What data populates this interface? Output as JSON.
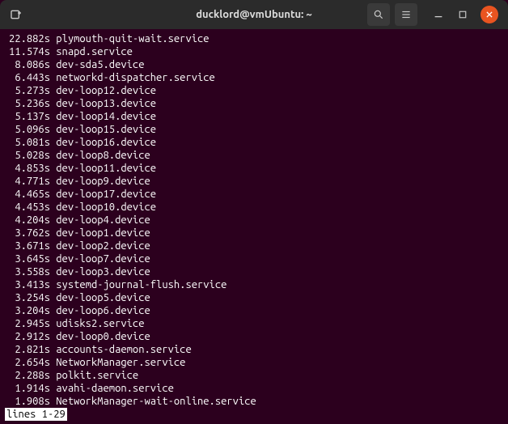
{
  "titlebar": {
    "title": "ducklord@vmUbuntu: ~"
  },
  "lines": [
    {
      "time": "22.882s",
      "name": "plymouth-quit-wait.service"
    },
    {
      "time": "11.574s",
      "name": "snapd.service"
    },
    {
      "time": "8.086s",
      "name": "dev-sda5.device"
    },
    {
      "time": "6.443s",
      "name": "networkd-dispatcher.service"
    },
    {
      "time": "5.273s",
      "name": "dev-loop12.device"
    },
    {
      "time": "5.236s",
      "name": "dev-loop13.device"
    },
    {
      "time": "5.137s",
      "name": "dev-loop14.device"
    },
    {
      "time": "5.096s",
      "name": "dev-loop15.device"
    },
    {
      "time": "5.081s",
      "name": "dev-loop16.device"
    },
    {
      "time": "5.028s",
      "name": "dev-loop8.device"
    },
    {
      "time": "4.853s",
      "name": "dev-loop11.device"
    },
    {
      "time": "4.771s",
      "name": "dev-loop9.device"
    },
    {
      "time": "4.465s",
      "name": "dev-loop17.device"
    },
    {
      "time": "4.453s",
      "name": "dev-loop10.device"
    },
    {
      "time": "4.204s",
      "name": "dev-loop4.device"
    },
    {
      "time": "3.762s",
      "name": "dev-loop1.device"
    },
    {
      "time": "3.671s",
      "name": "dev-loop2.device"
    },
    {
      "time": "3.645s",
      "name": "dev-loop7.device"
    },
    {
      "time": "3.558s",
      "name": "dev-loop3.device"
    },
    {
      "time": "3.413s",
      "name": "systemd-journal-flush.service"
    },
    {
      "time": "3.254s",
      "name": "dev-loop5.device"
    },
    {
      "time": "3.204s",
      "name": "dev-loop6.device"
    },
    {
      "time": "2.945s",
      "name": "udisks2.service"
    },
    {
      "time": "2.912s",
      "name": "dev-loop0.device"
    },
    {
      "time": "2.821s",
      "name": "accounts-daemon.service"
    },
    {
      "time": "2.654s",
      "name": "NetworkManager.service"
    },
    {
      "time": "2.288s",
      "name": "polkit.service"
    },
    {
      "time": "1.914s",
      "name": "avahi-daemon.service"
    },
    {
      "time": "1.908s",
      "name": "NetworkManager-wait-online.service"
    }
  ],
  "status": "lines 1-29"
}
